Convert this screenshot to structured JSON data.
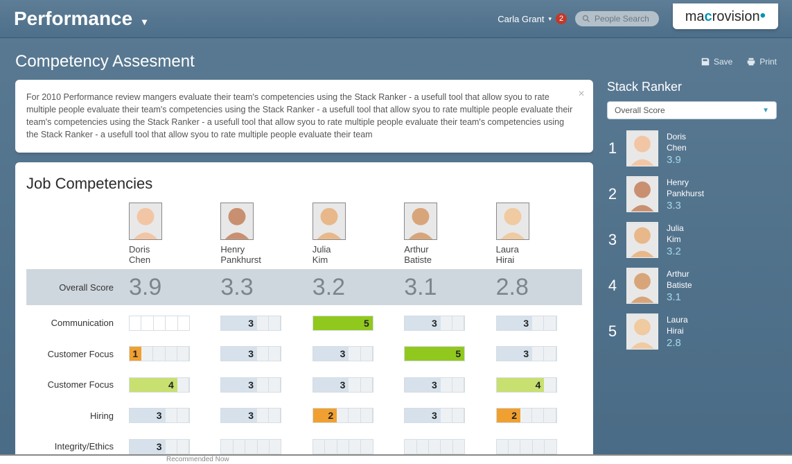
{
  "header": {
    "app_title": "Performance",
    "user_name": "Carla Grant",
    "notification_count": "2",
    "search_placeholder": "People Search",
    "logo_pre": "ma",
    "logo_o": "c",
    "logo_post": "rovision"
  },
  "page": {
    "title": "Competency Assesment",
    "save_label": "Save",
    "print_label": "Print"
  },
  "info_text": "For 2010 Performance review mangers evaluate their team's competencies using the Stack Ranker - a usefull tool that allow syou to rate multiple people evaluate their team's competencies using the Stack Ranker - a usefull tool that allow syou to rate multiple people evaluate their team's competencies using the Stack Ranker - a usefull tool that allow syou to rate multiple people evaluate their team's competencies using the Stack Ranker - a usefull tool that allow syou to rate multiple people evaluate their team",
  "competencies": {
    "card_title": "Job Competencies",
    "overall_label": "Overall Score",
    "people": [
      {
        "first": "Doris",
        "last": "Chen",
        "overall": "3.9"
      },
      {
        "first": "Henry",
        "last": "Pankhurst",
        "overall": "3.3"
      },
      {
        "first": "Julia",
        "last": "Kim",
        "overall": "3.2"
      },
      {
        "first": "Arthur",
        "last": "Batiste",
        "overall": "3.1"
      },
      {
        "first": "Laura",
        "last": "Hirai",
        "overall": "2.8"
      }
    ],
    "rows": [
      {
        "label": "Communication",
        "cells": [
          {
            "v": null,
            "style": "empty"
          },
          {
            "v": "3",
            "style": "blue"
          },
          {
            "v": "5",
            "style": "green"
          },
          {
            "v": "3",
            "style": "blue"
          },
          {
            "v": "3",
            "style": "blue"
          }
        ]
      },
      {
        "label": "Customer Focus",
        "cells": [
          {
            "v": "1",
            "style": "orange"
          },
          {
            "v": "3",
            "style": "blue"
          },
          {
            "v": "3",
            "style": "blue"
          },
          {
            "v": "5",
            "style": "green"
          },
          {
            "v": "3",
            "style": "blue"
          }
        ]
      },
      {
        "label": "Customer Focus",
        "cells": [
          {
            "v": "4",
            "style": "lime"
          },
          {
            "v": "3",
            "style": "blue"
          },
          {
            "v": "3",
            "style": "blue"
          },
          {
            "v": "3",
            "style": "blue"
          },
          {
            "v": "4",
            "style": "lime"
          }
        ]
      },
      {
        "label": "Hiring",
        "cells": [
          {
            "v": "3",
            "style": "blue"
          },
          {
            "v": "3",
            "style": "blue"
          },
          {
            "v": "2",
            "style": "orange"
          },
          {
            "v": "3",
            "style": "blue"
          },
          {
            "v": "2",
            "style": "orange"
          }
        ]
      },
      {
        "label": "Integrity/Ethics",
        "cells": [
          {
            "v": "3",
            "style": "blue"
          },
          {
            "v": null,
            "style": "blue"
          },
          {
            "v": null,
            "style": "blue"
          },
          {
            "v": null,
            "style": "blue"
          },
          {
            "v": null,
            "style": "blue"
          }
        ]
      }
    ]
  },
  "stack_ranker": {
    "title": "Stack Ranker",
    "select_label": "Overall Score",
    "items": [
      {
        "rank": "1",
        "first": "Doris",
        "last": "Chen",
        "score": "3.9"
      },
      {
        "rank": "2",
        "first": "Henry",
        "last": "Pankhurst",
        "score": "3.3"
      },
      {
        "rank": "3",
        "first": "Julia",
        "last": "Kim",
        "score": "3.2"
      },
      {
        "rank": "4",
        "first": "Arthur",
        "last": "Batiste",
        "score": "3.1"
      },
      {
        "rank": "5",
        "first": "Laura",
        "last": "Hirai",
        "score": "2.8"
      }
    ]
  },
  "bottom_hint": "Recommended Now",
  "chart_data": {
    "type": "table",
    "title": "Job Competencies – ratings 1..5",
    "columns": [
      "Doris Chen",
      "Henry Pankhurst",
      "Julia Kim",
      "Arthur Batiste",
      "Laura Hirai"
    ],
    "overall": [
      3.9,
      3.3,
      3.2,
      3.1,
      2.8
    ],
    "rows": {
      "Communication": [
        null,
        3,
        5,
        3,
        3
      ],
      "Customer Focus": [
        1,
        3,
        3,
        5,
        3
      ],
      "Customer Focus ": [
        4,
        3,
        3,
        3,
        4
      ],
      "Hiring": [
        3,
        3,
        2,
        3,
        2
      ],
      "Integrity/Ethics": [
        3,
        null,
        null,
        null,
        null
      ]
    }
  }
}
